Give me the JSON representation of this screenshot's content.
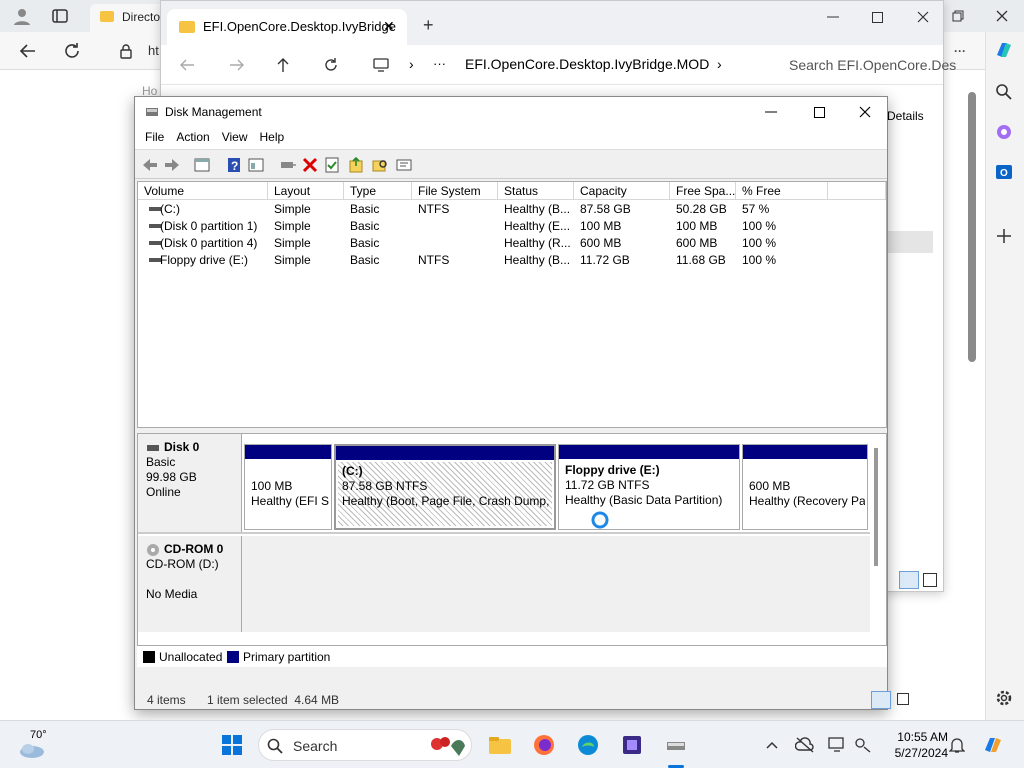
{
  "edge": {
    "tab_title": "Directo",
    "address_partial": "ht",
    "page_fragment": "Ho"
  },
  "explorer": {
    "tab_title": "EFI.OpenCore.Desktop.IvyBridge",
    "breadcrumb_ellipsis": "···",
    "breadcrumb_path": "EFI.OpenCore.Desktop.IvyBridge.MOD",
    "search_placeholder": "Search EFI.OpenCore.Des",
    "details_label": "Details"
  },
  "disk_management": {
    "title": "Disk Management",
    "menu": [
      "File",
      "Action",
      "View",
      "Help"
    ],
    "columns": [
      "Volume",
      "Layout",
      "Type",
      "File System",
      "Status",
      "Capacity",
      "Free Spa...",
      "% Free"
    ],
    "rows": [
      [
        "(C:)",
        "Simple",
        "Basic",
        "NTFS",
        "Healthy (B...",
        "87.58 GB",
        "50.28 GB",
        "57 %"
      ],
      [
        "(Disk 0 partition 1)",
        "Simple",
        "Basic",
        "",
        "Healthy (E...",
        "100 MB",
        "100 MB",
        "100 %"
      ],
      [
        "(Disk 0 partition 4)",
        "Simple",
        "Basic",
        "",
        "Healthy (R...",
        "600 MB",
        "600 MB",
        "100 %"
      ],
      [
        "Floppy drive (E:)",
        "Simple",
        "Basic",
        "NTFS",
        "Healthy (B...",
        "11.72 GB",
        "11.68 GB",
        "100 %"
      ]
    ],
    "disk0": {
      "name": "Disk 0",
      "type": "Basic",
      "size": "99.98 GB",
      "state": "Online",
      "partitions": [
        {
          "title": "",
          "size": "100 MB",
          "status": "Healthy (EFI Sy"
        },
        {
          "title": "(C:)",
          "size": "87.58 GB NTFS",
          "status": "Healthy (Boot, Page File, Crash Dump, E"
        },
        {
          "title": "Floppy drive  (E:)",
          "size": "11.72 GB NTFS",
          "status": "Healthy (Basic Data Partition)"
        },
        {
          "title": "",
          "size": "600 MB",
          "status": "Healthy (Recovery Pa"
        }
      ]
    },
    "cdrom0": {
      "name": "CD-ROM 0",
      "drive": "CD-ROM (D:)",
      "media": "No Media"
    },
    "legend": {
      "unallocated": "Unallocated",
      "primary": "Primary partition",
      "primary_color": "#000080",
      "unallocated_color": "#000000"
    },
    "status": {
      "items": "4 items",
      "selected": "1 item selected  4.64 MB"
    }
  },
  "taskbar": {
    "weather_temp": "70°",
    "search_label": "Search",
    "time": "10:55 AM",
    "date": "5/27/2024"
  }
}
